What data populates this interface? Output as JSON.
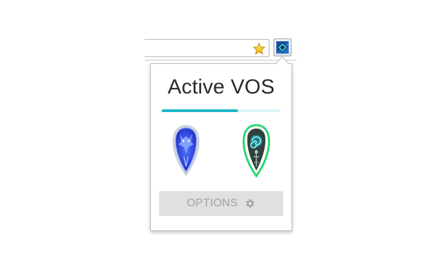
{
  "toolbar": {
    "bookmark_icon": "star-icon",
    "extension_icon": "vos-extension-icon"
  },
  "popup": {
    "title": "Active VOS",
    "progress": 0.64,
    "emblems": [
      {
        "name": "blue-wolf-emblem",
        "color": "#3b5cff"
      },
      {
        "name": "green-swirl-emblem",
        "color": "#2fe07a"
      }
    ],
    "options_label": "OPTIONS",
    "options_icon": "gear-icon"
  },
  "colors": {
    "accent": "#1fb9c7",
    "track": "#d9f4f6",
    "button_bg": "#e0e0e0",
    "button_text": "#a3a3a3"
  }
}
